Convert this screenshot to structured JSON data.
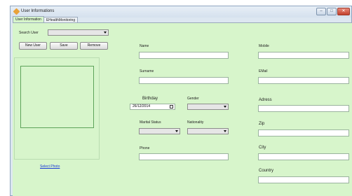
{
  "window": {
    "title": "User Informations",
    "controls": {
      "minimize": "‒",
      "maximize": "□",
      "close": "✕"
    }
  },
  "tabs": [
    "User Information",
    "EHealthMonitoring"
  ],
  "search_user": {
    "label": "Search User",
    "value": ""
  },
  "buttons": {
    "new_user": "New User",
    "save": "Save",
    "remove": "Remove"
  },
  "photo": {
    "link": "Select Photo"
  },
  "fields": {
    "name": {
      "label": "Name",
      "value": ""
    },
    "surname": {
      "label": "Surname",
      "value": ""
    },
    "birthday": {
      "label": "Birthday",
      "value": "26/12/2014"
    },
    "gender": {
      "label": "Gender",
      "value": ""
    },
    "marital_status": {
      "label": "Marital Status",
      "value": ""
    },
    "nationality": {
      "label": "Nationality",
      "value": ""
    },
    "phone": {
      "label": "Phone",
      "value": ""
    },
    "mobile": {
      "label": "Mobile",
      "value": ""
    },
    "email": {
      "label": "EMail",
      "value": ""
    },
    "address": {
      "label": "Adress",
      "value": ""
    },
    "zip": {
      "label": "Zip",
      "value": ""
    },
    "city": {
      "label": "City",
      "value": ""
    },
    "country": {
      "label": "Country",
      "value": ""
    }
  },
  "colors": {
    "panel": "#d7f5cb",
    "window_frame": "#dde7f1",
    "link": "#1a3bd8",
    "close_button": "#c2402c"
  }
}
